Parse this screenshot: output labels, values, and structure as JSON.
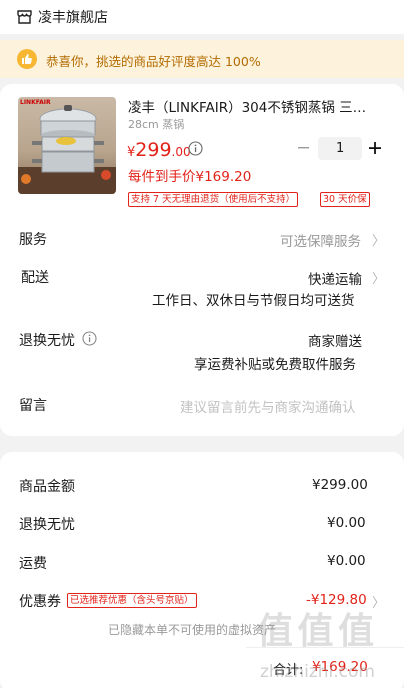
{
  "store": {
    "name": "凌丰旗舰店"
  },
  "banner": {
    "text": "恭喜你，挑选的商品好评度高达 100%"
  },
  "product": {
    "image_brand": "LINKFAIR",
    "title": "凌丰（LINKFAIR）304不锈钢蒸锅 三…",
    "spec": "28cm 蒸锅",
    "price_symbol": "¥",
    "price_int": "299",
    "price_dec": ".00",
    "final_price": "每件到手价¥169.20",
    "tags": [
      "支持 7 天无理由退货（使用后不支持）",
      "30 天价保"
    ],
    "quantity": "1",
    "minus": "−",
    "plus": "+"
  },
  "service": {
    "label": "服务",
    "value": "可选保障服务"
  },
  "delivery": {
    "label": "配送",
    "value": "快递运输",
    "note": "工作日、双休日与节假日均可送货"
  },
  "return": {
    "label": "退换无忧",
    "value": "商家赠送",
    "note": "享运费补贴或免费取件服务"
  },
  "message": {
    "label": "留言",
    "placeholder": "建议留言前先与商家沟通确认"
  },
  "summary": {
    "goods_label": "商品金额",
    "goods_value": "¥299.00",
    "return_label": "退换无忧",
    "return_value": "¥0.00",
    "shipping_label": "运费",
    "shipping_value": "¥0.00",
    "coupon_label": "优惠券",
    "coupon_tag": "已选推荐优惠（含头号京贴）",
    "coupon_value": "-¥129.80",
    "hidden_note": "已隐藏本单不可使用的虚拟资产",
    "total_label": "合计:",
    "total_value": "¥169.20"
  },
  "watermark": {
    "logo": "值 值 值",
    "site": "zhizhizhi.com"
  },
  "icons": [
    "store-icon",
    "thumbs-up-icon",
    "info-icon",
    "chevron-right-icon",
    "minus-icon",
    "plus-icon"
  ],
  "colors": {
    "accent": "#e2231a",
    "banner_bg": "#fdf3dc",
    "banner_text": "#b36b00",
    "badge": "#f7b733"
  }
}
